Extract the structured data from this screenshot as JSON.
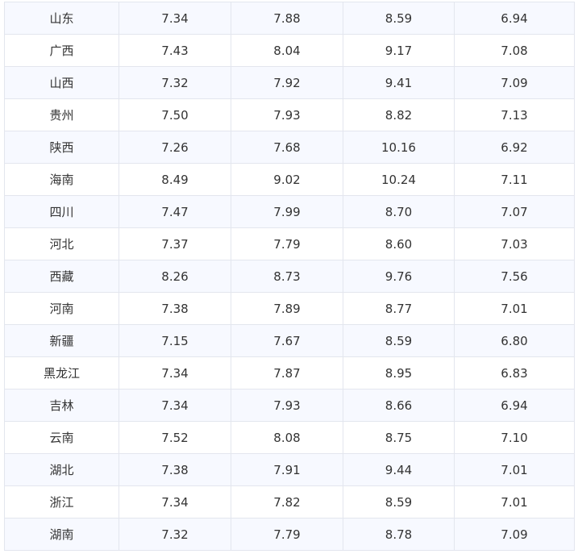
{
  "table": {
    "rows": [
      [
        "山东",
        "7.34",
        "7.88",
        "8.59",
        "6.94"
      ],
      [
        "广西",
        "7.43",
        "8.04",
        "9.17",
        "7.08"
      ],
      [
        "山西",
        "7.32",
        "7.92",
        "9.41",
        "7.09"
      ],
      [
        "贵州",
        "7.50",
        "7.93",
        "8.82",
        "7.13"
      ],
      [
        "陕西",
        "7.26",
        "7.68",
        "10.16",
        "6.92"
      ],
      [
        "海南",
        "8.49",
        "9.02",
        "10.24",
        "7.11"
      ],
      [
        "四川",
        "7.47",
        "7.99",
        "8.70",
        "7.07"
      ],
      [
        "河北",
        "7.37",
        "7.79",
        "8.60",
        "7.03"
      ],
      [
        "西藏",
        "8.26",
        "8.73",
        "9.76",
        "7.56"
      ],
      [
        "河南",
        "7.38",
        "7.89",
        "8.77",
        "7.01"
      ],
      [
        "新疆",
        "7.15",
        "7.67",
        "8.59",
        "6.80"
      ],
      [
        "黑龙江",
        "7.34",
        "7.87",
        "8.95",
        "6.83"
      ],
      [
        "吉林",
        "7.34",
        "7.93",
        "8.66",
        "6.94"
      ],
      [
        "云南",
        "7.52",
        "8.08",
        "8.75",
        "7.10"
      ],
      [
        "湖北",
        "7.38",
        "7.91",
        "9.44",
        "7.01"
      ],
      [
        "浙江",
        "7.34",
        "7.82",
        "8.59",
        "7.01"
      ],
      [
        "湖南",
        "7.32",
        "7.79",
        "8.78",
        "7.09"
      ]
    ]
  }
}
